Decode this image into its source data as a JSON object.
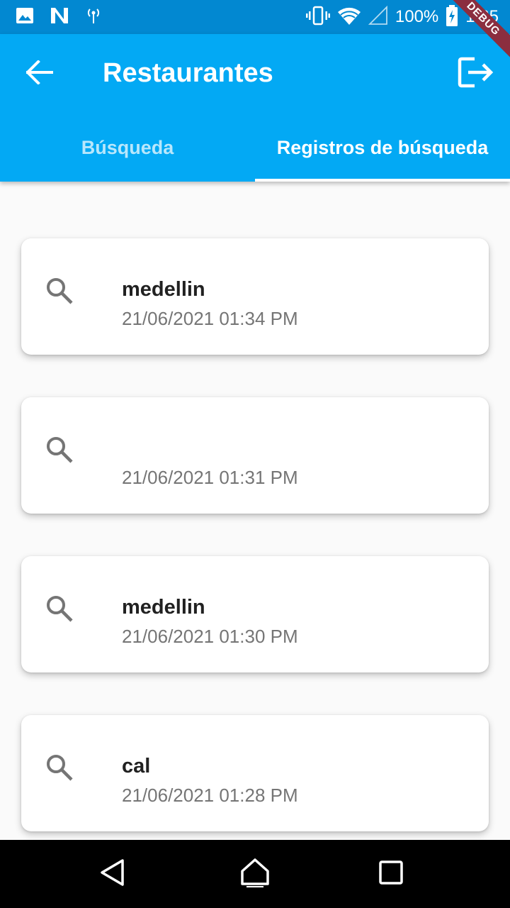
{
  "status_bar": {
    "battery": "100%",
    "time": "1:35",
    "debug_label": "DEBUG",
    "icons": [
      "image-icon",
      "n-app-icon",
      "hotspot-icon",
      "vibrate-icon",
      "wifi-icon",
      "signal-icon",
      "battery-charging-icon"
    ]
  },
  "app_bar": {
    "title": "Restaurantes",
    "back_icon": "arrow-back-icon",
    "logout_icon": "logout-icon"
  },
  "tabs": [
    {
      "label": "Búsqueda",
      "active": false
    },
    {
      "label": "Registros de búsqueda",
      "active": true
    }
  ],
  "history": [
    {
      "query": "medellin",
      "date": "21/06/2021 01:34 PM"
    },
    {
      "query": "",
      "date": "21/06/2021 01:31 PM"
    },
    {
      "query": "medellin",
      "date": "21/06/2021 01:30 PM"
    },
    {
      "query": "cal",
      "date": "21/06/2021 01:28 PM"
    }
  ],
  "colors": {
    "status_bar": "#0288d1",
    "app_bar": "#03a9f4",
    "background": "#fafafa",
    "icon_gray": "#757575"
  }
}
